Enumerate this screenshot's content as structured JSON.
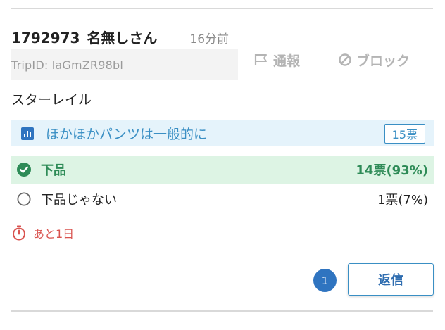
{
  "post": {
    "id": "1792973",
    "author": "名無しさん",
    "time": "16分前",
    "trip": "TripID: laGmZR98bl",
    "body": "スターレイル"
  },
  "actions": {
    "report_label": "通報",
    "block_label": "ブロック",
    "report_icon": "flag-icon",
    "block_icon": "ban-icon"
  },
  "poll": {
    "question": "ほかほかパンツは一般的に",
    "total_votes": "15票",
    "options": [
      {
        "label": "下品",
        "result": "14票(93%)",
        "share": 0.93,
        "selected": true
      },
      {
        "label": "下品じゃない",
        "result": "1票(7%)",
        "share": 0.07,
        "selected": false
      }
    ],
    "remaining": "あと1日"
  },
  "footer": {
    "reply_count": "1",
    "reply_label": "返信"
  },
  "colors": {
    "accent": "#3a8fc4",
    "winner": "#2e8b57",
    "winner_bg": "#ddf4e4",
    "question_bg": "#e5f3fb",
    "timer": "#d9534f",
    "badge": "#2f74c0"
  }
}
